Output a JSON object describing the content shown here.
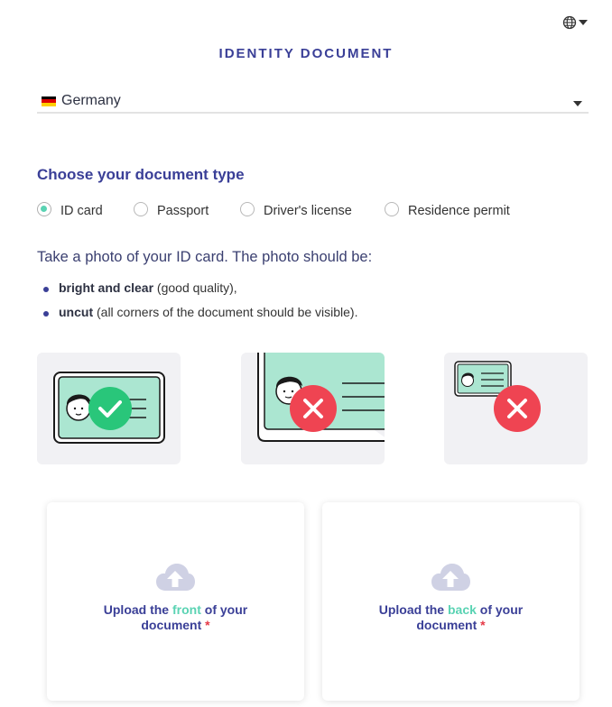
{
  "header": {
    "language_icon": "globe-icon",
    "title": "IDENTITY DOCUMENT"
  },
  "country": {
    "flag_icon": "germany-flag-icon",
    "flag_colors": [
      "#000000",
      "#dd0000",
      "#ffce00"
    ],
    "selected": "Germany"
  },
  "document_type": {
    "heading": "Choose your document type",
    "options": [
      {
        "label": "ID card",
        "selected": true
      },
      {
        "label": "Passport",
        "selected": false
      },
      {
        "label": "Driver's license",
        "selected": false
      },
      {
        "label": "Residence permit",
        "selected": false
      }
    ]
  },
  "instructions": {
    "intro": "Take a photo of your ID card. The photo should be:",
    "requirements": [
      {
        "bold": "bright and clear",
        "rest": " (good quality),"
      },
      {
        "bold": "uncut",
        "rest": " (all corners of the document should be visible)."
      }
    ]
  },
  "examples": [
    {
      "kind": "correct",
      "icon": "checkmark-icon"
    },
    {
      "kind": "cut-off",
      "icon": "cross-icon"
    },
    {
      "kind": "too-small",
      "icon": "cross-icon"
    }
  ],
  "uploads": {
    "front": {
      "prefix": "Upload the ",
      "highlight": "front",
      "suffix": " of your document",
      "required_mark": "*"
    },
    "back": {
      "prefix": "Upload the ",
      "highlight": "back",
      "suffix": " of your document",
      "required_mark": "*"
    }
  },
  "colors": {
    "primary": "#3a3f97",
    "accent": "#5ad3b3",
    "error": "#ef4452",
    "success": "#29c67a",
    "required": "#e53946"
  }
}
